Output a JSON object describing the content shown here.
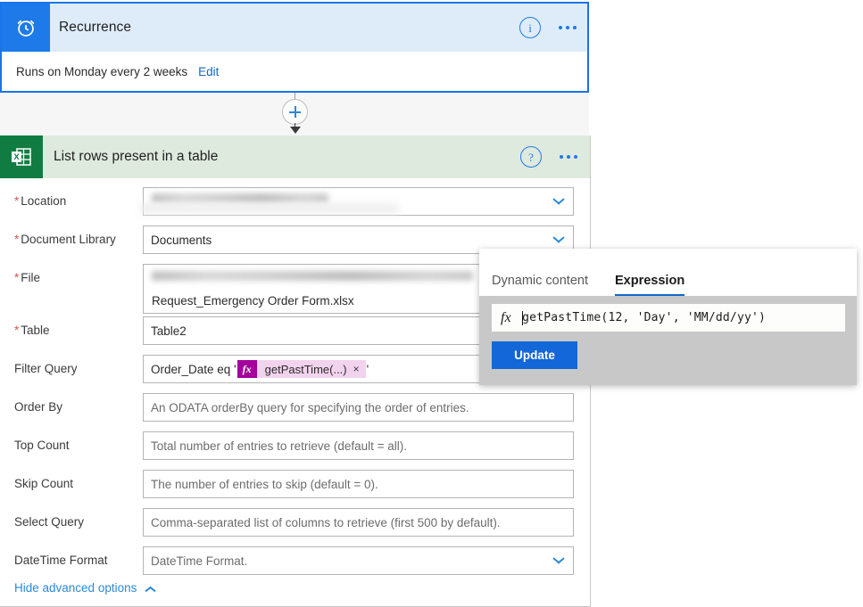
{
  "recurrence": {
    "icon": "alarm-clock-icon",
    "title": "Recurrence",
    "info_icon": "info-circle-icon",
    "more_icon": "ellipsis-icon",
    "summary": "Runs on Monday every 2 weeks",
    "edit_label": "Edit"
  },
  "connector": {
    "add_icon": "plus-circle-icon",
    "arrow_icon": "arrow-down-icon"
  },
  "excel_action": {
    "icon": "excel-icon",
    "title": "List rows present in a table",
    "help_icon": "question-circle-icon",
    "more_icon": "ellipsis-icon",
    "fields": [
      {
        "label": "Location",
        "required": true,
        "value": "",
        "placeholder": "",
        "redacted": true,
        "dropdown": true
      },
      {
        "label": "Document Library",
        "required": true,
        "value": "Documents",
        "placeholder": "",
        "redacted": false,
        "dropdown": true
      },
      {
        "label": "File",
        "required": true,
        "value": "Request_Emergency Order Form.xlsx",
        "placeholder": "",
        "redacted": true,
        "dropdown": false
      },
      {
        "label": "Table",
        "required": true,
        "value": "Table2",
        "placeholder": "",
        "redacted": false,
        "dropdown": false
      },
      {
        "label": "Filter Query",
        "required": false,
        "value": "",
        "placeholder": "",
        "redacted": false,
        "dropdown": false
      },
      {
        "label": "Order By",
        "required": false,
        "value": "",
        "placeholder": "An ODATA orderBy query for specifying the order of entries.",
        "redacted": false,
        "dropdown": false
      },
      {
        "label": "Top Count",
        "required": false,
        "value": "",
        "placeholder": "Total number of entries to retrieve (default = all).",
        "redacted": false,
        "dropdown": false
      },
      {
        "label": "Skip Count",
        "required": false,
        "value": "",
        "placeholder": "The number of entries to skip (default = 0).",
        "redacted": false,
        "dropdown": false
      },
      {
        "label": "Select Query",
        "required": false,
        "value": "",
        "placeholder": "Comma-separated list of columns to retrieve (first 500 by default).",
        "redacted": false,
        "dropdown": false
      },
      {
        "label": "DateTime Format",
        "required": false,
        "value": "",
        "placeholder": "DateTime Format.",
        "redacted": false,
        "dropdown": true
      }
    ],
    "filter_query": {
      "prefix": "Order_Date eq '",
      "token_fx": "fx",
      "token_label": "getPastTime(...)",
      "token_remove": "×",
      "suffix": "'"
    },
    "advanced_toggle": {
      "label": "Hide advanced options",
      "icon": "chevron-up-icon"
    }
  },
  "expression_popup": {
    "tabs": [
      {
        "label": "Dynamic content",
        "active": false
      },
      {
        "label": "Expression",
        "active": true
      }
    ],
    "fx_glyph": "fx",
    "expression": "getPastTime(12, 'Day', 'MM/dd/yy')",
    "update_label": "Update"
  },
  "colors": {
    "recurrence_accent": "#1e7ae8",
    "recurrence_header_bg": "#deecf9",
    "card_border": "#1a73e8",
    "excel_accent": "#107c41",
    "excel_header_bg": "#dfeade",
    "link": "#2b88d8",
    "required": "#d9534f",
    "token_fx_bg": "#a4009a",
    "token_bg": "#f2d3ee",
    "popup_body_bg": "#c8c8c8",
    "update_btn_bg": "#1367d8",
    "tab_underline": "#1466c8"
  }
}
